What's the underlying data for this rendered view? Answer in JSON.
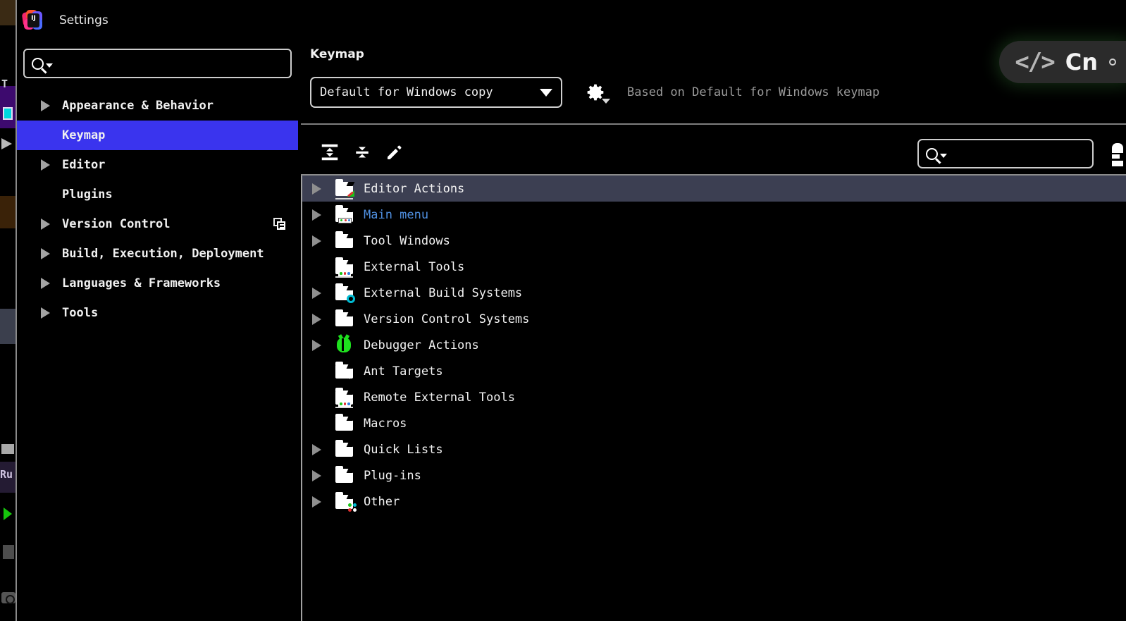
{
  "window": {
    "title": "Settings",
    "logo_icon": "intellij-idea-logo"
  },
  "sidebar": {
    "search": {
      "value": "",
      "placeholder": "",
      "icon": "search-icon"
    },
    "items": [
      {
        "label": "Appearance & Behavior",
        "expandable": true,
        "selected": false
      },
      {
        "label": "Keymap",
        "expandable": false,
        "selected": true
      },
      {
        "label": "Editor",
        "expandable": true,
        "selected": false
      },
      {
        "label": "Plugins",
        "expandable": false,
        "selected": false
      },
      {
        "label": "Version Control",
        "expandable": true,
        "selected": false,
        "trailing_icon": "copy-icon"
      },
      {
        "label": "Build, Execution, Deployment",
        "expandable": true,
        "selected": false
      },
      {
        "label": "Languages & Frameworks",
        "expandable": true,
        "selected": false
      },
      {
        "label": "Tools",
        "expandable": true,
        "selected": false
      }
    ]
  },
  "main": {
    "title": "Keymap",
    "keymap_select": {
      "value": "Default for Windows copy",
      "caret_icon": "chevron-down-icon"
    },
    "gear_button": {
      "icon": "gear-icon",
      "caret_icon": "chevron-down-icon"
    },
    "based_on": "Based on Default for Windows keymap",
    "toolbar": {
      "expand_all": "expand-all-icon",
      "collapse_all": "collapse-all-icon",
      "edit": "pencil-icon",
      "search": {
        "value": "",
        "placeholder": "",
        "icon": "search-icon"
      },
      "edge": "filter-icon"
    },
    "tree": [
      {
        "label": "Editor Actions",
        "expandable": true,
        "selected": true,
        "icon": "folder-edit-icon",
        "color": "default"
      },
      {
        "label": "Main menu",
        "expandable": true,
        "selected": false,
        "icon": "folder-menu-icon",
        "color": "blue"
      },
      {
        "label": "Tool Windows",
        "expandable": true,
        "selected": false,
        "icon": "folder-icon",
        "color": "default"
      },
      {
        "label": "External Tools",
        "expandable": false,
        "selected": false,
        "icon": "folder-tools-icon",
        "color": "default"
      },
      {
        "label": "External Build Systems",
        "expandable": true,
        "selected": false,
        "icon": "folder-gear-icon",
        "color": "default"
      },
      {
        "label": "Version Control Systems",
        "expandable": true,
        "selected": false,
        "icon": "folder-icon",
        "color": "default"
      },
      {
        "label": "Debugger Actions",
        "expandable": true,
        "selected": false,
        "icon": "bug-icon",
        "color": "default"
      },
      {
        "label": "Ant Targets",
        "expandable": false,
        "selected": false,
        "icon": "folder-ant-icon",
        "color": "default"
      },
      {
        "label": "Remote External Tools",
        "expandable": false,
        "selected": false,
        "icon": "folder-tools-icon",
        "color": "default"
      },
      {
        "label": "Macros",
        "expandable": false,
        "selected": false,
        "icon": "folder-icon",
        "color": "default"
      },
      {
        "label": "Quick Lists",
        "expandable": true,
        "selected": false,
        "icon": "folder-icon",
        "color": "default"
      },
      {
        "label": "Plug-ins",
        "expandable": true,
        "selected": false,
        "icon": "folder-icon",
        "color": "default"
      },
      {
        "label": "Other",
        "expandable": true,
        "selected": false,
        "icon": "folder-other-icon",
        "color": "default"
      }
    ]
  },
  "overlay_badge": {
    "code_glyph": "</>",
    "label": "Cn",
    "icon": "code-brackets-icon"
  },
  "ide_strip": {
    "tool_label": "T",
    "run_label": "Ru",
    "run_icon": "play-icon"
  },
  "colors": {
    "selection_blue": "#3a34ee",
    "tree_selection": "#3c3f52",
    "link_blue": "#4f8fe0",
    "muted_text": "#9a9a9a",
    "background": "#000000"
  }
}
